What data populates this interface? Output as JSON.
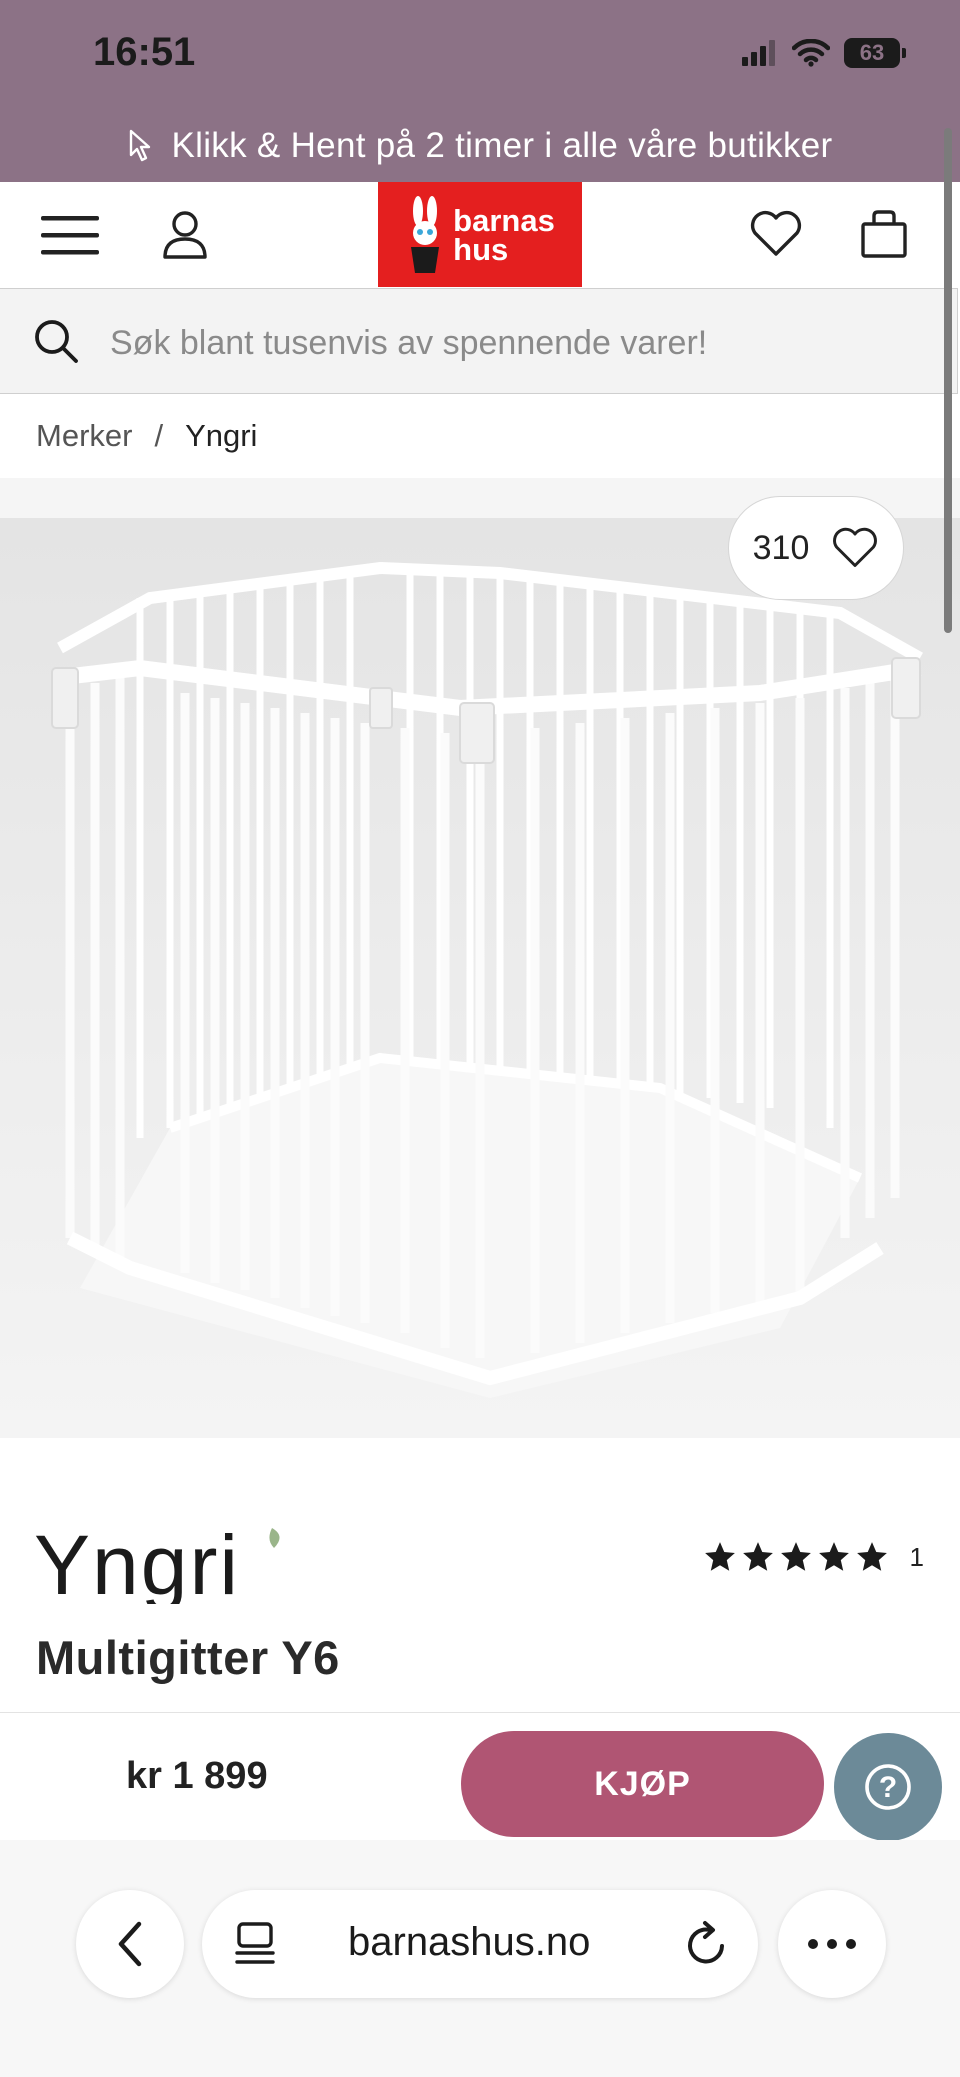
{
  "status_bar": {
    "time": "16:51",
    "battery": "63"
  },
  "promo": {
    "text": "Klikk & Hent på 2 timer i alle våre butikker"
  },
  "header": {
    "logo_line1": "barnas",
    "logo_line2": "hus"
  },
  "search": {
    "placeholder": "Søk blant tusenvis av spennende varer!"
  },
  "breadcrumb": {
    "items": [
      "Merker",
      "Yngri"
    ],
    "separator": "/"
  },
  "product": {
    "favorites_count": "310",
    "brand": "Yngri",
    "title": "Multigitter Y6",
    "rating_stars": 5,
    "rating_count": "1",
    "price": "kr 1 899"
  },
  "buy_bar": {
    "buy_label": "KJØP",
    "help_symbol": "?"
  },
  "browser": {
    "url": "barnashus.no"
  },
  "colors": {
    "accent_purple": "#8c7286",
    "buy_pink": "#b05573",
    "logo_red": "#e41f1f",
    "help_blue": "#6c8a98"
  }
}
